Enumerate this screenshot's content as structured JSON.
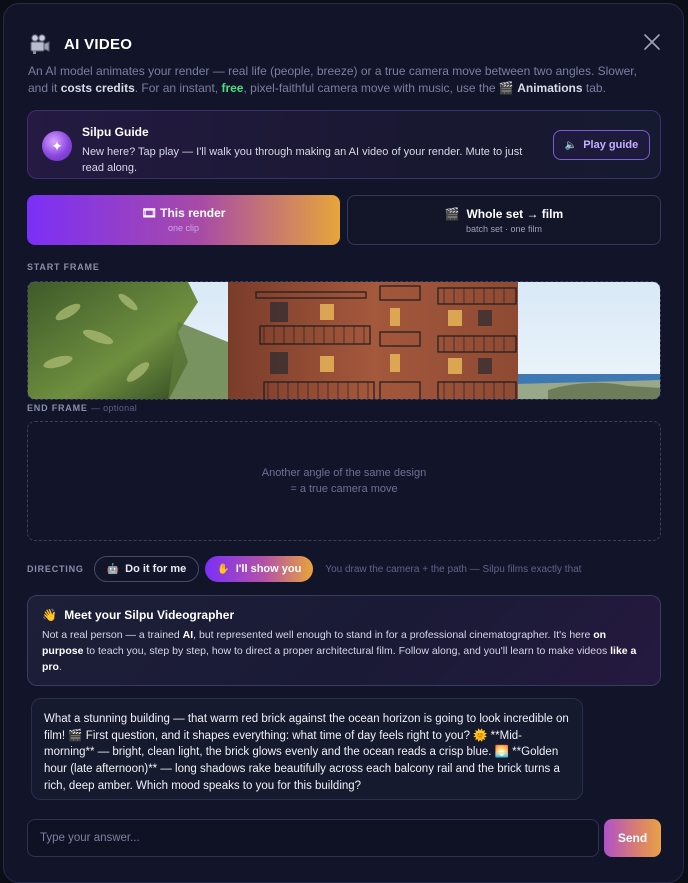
{
  "header": {
    "title": "AI VIDEO",
    "icon": "movie-camera-icon"
  },
  "intro": {
    "part1": "An AI model animates your render — real life (people, breeze) or a true camera move between two angles. Slower, and it ",
    "costs": "costs credits",
    "part2": ". For an instant, ",
    "free": "free",
    "part3": ", pixel-faithful camera move with music, use the ",
    "tab_icon": "🎬",
    "tab_name": "Animations",
    "part4": " tab."
  },
  "guide": {
    "title": "Silpu Guide",
    "text": "New here? Tap play — I'll walk you through making an AI video of your render. Mute to just read along.",
    "play_label": "Play guide",
    "play_icon": "🔈"
  },
  "modes": {
    "render": {
      "icon": "🎞",
      "label": "This render",
      "sub": "one clip"
    },
    "film": {
      "icon": "🎬",
      "label": "Whole set → film",
      "sub": "batch set · one film"
    }
  },
  "start_frame": {
    "label": "START FRAME"
  },
  "end_frame": {
    "label": "END FRAME",
    "optional": "— optional",
    "line1": "Another angle of the same design",
    "line2": "= a true camera move"
  },
  "directing": {
    "label": "DIRECTING",
    "auto_icon": "🤖",
    "auto_label": "Do it for me",
    "manual_icon": "✋",
    "manual_label": "I'll show you",
    "hint": "You draw the camera + the path — Silpu films exactly that"
  },
  "videographer": {
    "icon": "👋",
    "title": "Meet your Silpu Videographer",
    "t1": "Not a real person — a trained ",
    "ai": "AI",
    "t2": ", but represented well enough to stand in for a professional cinematographer. It's here ",
    "on_purpose": "on purpose",
    "t3": " to teach you, step by step, how to direct a proper architectural film. Follow along, and you'll learn to make videos ",
    "like_pro": "like a pro",
    "t4": "."
  },
  "chat": {
    "message": "What a stunning building — that warm red brick against the ocean horizon is going to look incredible on film! 🎬 First question, and it shapes everything: what time of day feels right to you? 🌞 **Mid-morning** — bright, clean light, the brick glows evenly and the ocean reads a crisp blue. 🌅 **Golden hour (late afternoon)** — long shadows rake beautifully across each balcony rail and the brick turns a rich, deep amber. Which mood speaks to you for this building?"
  },
  "input": {
    "placeholder": "Type your answer...",
    "send_label": "Send"
  },
  "colors": {
    "accent_purple": "#7b2ff7",
    "accent_orange": "#e7a53a",
    "free_green": "#4ade80",
    "background": "#12152a"
  }
}
